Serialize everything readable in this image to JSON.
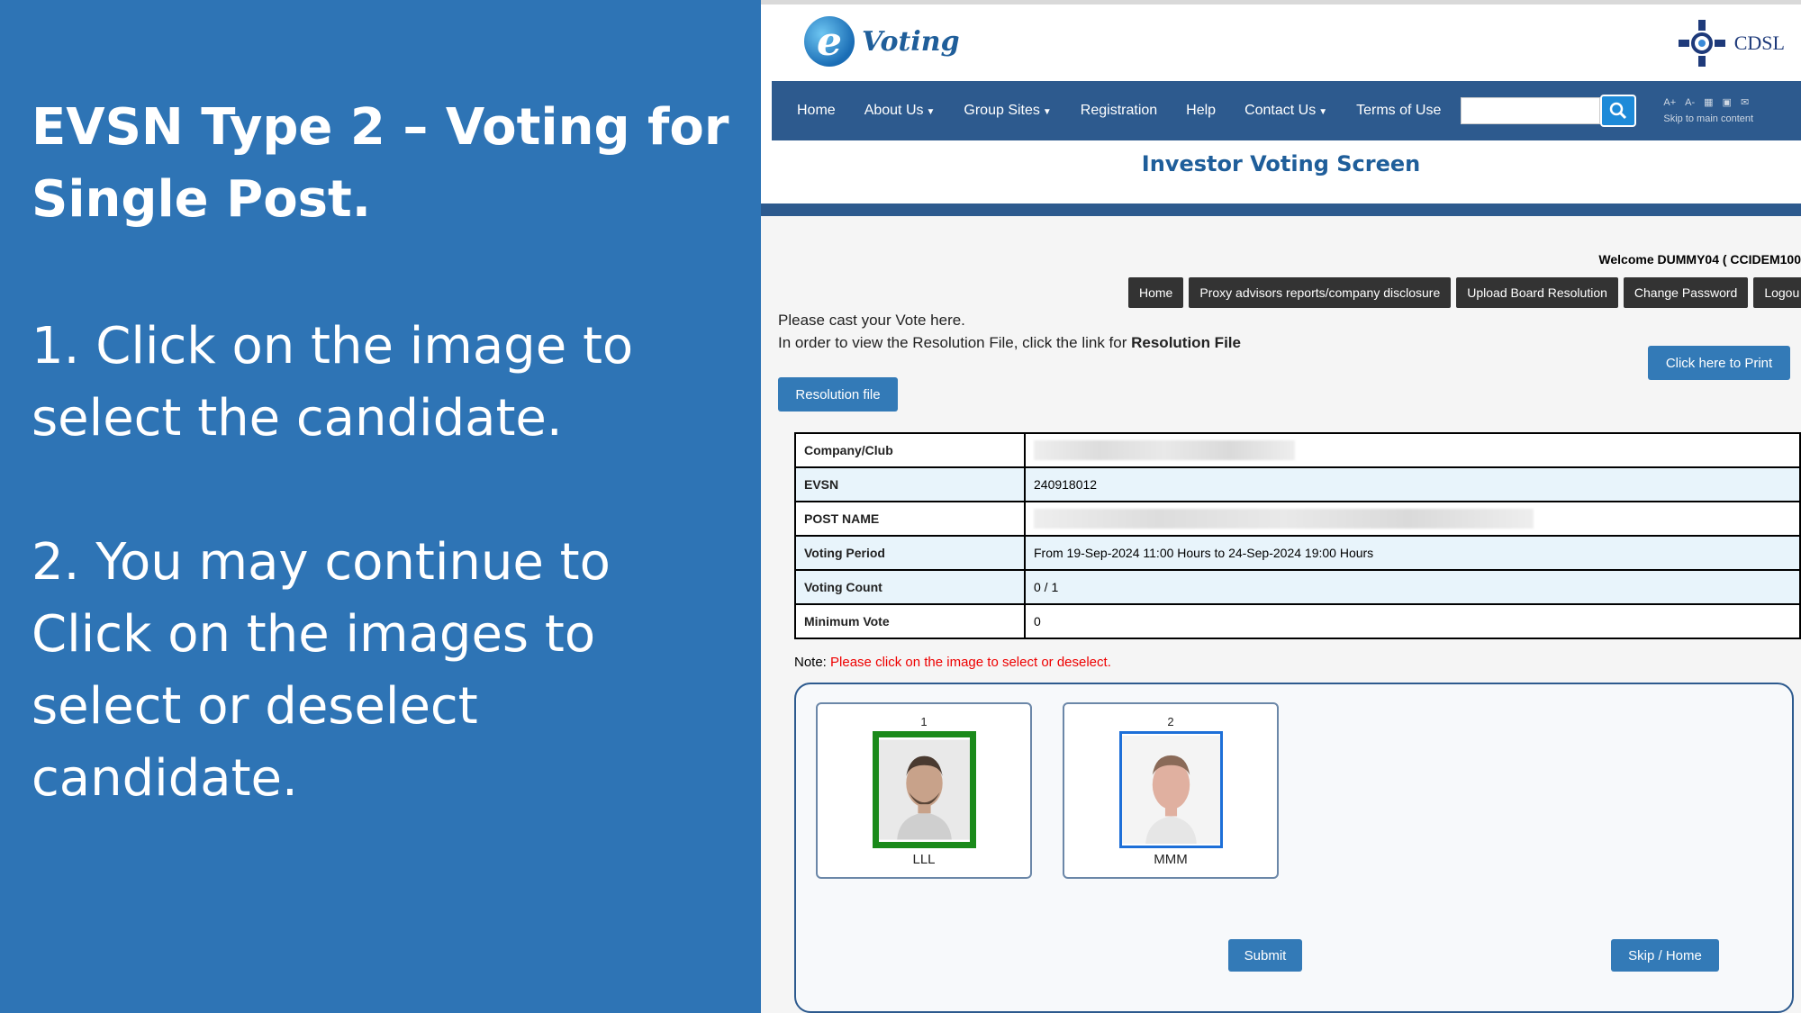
{
  "slide": {
    "title": "EVSN Type 2 – Voting for Single Post.",
    "step1": "1. Click on the image to select the candidate.",
    "step2": "2. You may continue to Click on the images to select or deselect candidate."
  },
  "header": {
    "logo_letter": "e",
    "logo_text": "Voting",
    "brand_right": "CDSL",
    "page_title": "Investor Voting Screen"
  },
  "nav": {
    "items": [
      {
        "label": "Home"
      },
      {
        "label": "About Us"
      },
      {
        "label": "Group Sites"
      },
      {
        "label": "Registration"
      },
      {
        "label": "Help"
      },
      {
        "label": "Contact Us"
      },
      {
        "label": "Terms of Use"
      }
    ],
    "search_placeholder": "",
    "font_up": "A+",
    "font_down": "A-",
    "skip_link": "Skip to main content"
  },
  "user": {
    "welcome": "Welcome DUMMY04 ( CCIDEM100"
  },
  "menu": [
    {
      "label": "Home"
    },
    {
      "label": "Proxy advisors reports/company disclosure"
    },
    {
      "label": "Upload Board Resolution"
    },
    {
      "label": "Change Password"
    },
    {
      "label": "Logou"
    }
  ],
  "instructions": {
    "line1": "Please cast your Vote here.",
    "line2_prefix": "In order to view the Resolution File, click the link for ",
    "line2_bold": "Resolution File"
  },
  "buttons": {
    "print": "Click here to Print",
    "resolution": "Resolution file",
    "submit": "Submit",
    "skip": "Skip / Home"
  },
  "details": [
    {
      "label": "Company/Club",
      "value": ""
    },
    {
      "label": "EVSN",
      "value": "240918012"
    },
    {
      "label": "POST NAME",
      "value": ""
    },
    {
      "label": "Voting Period",
      "value": "From 19-Sep-2024 11:00 Hours to 24-Sep-2024 19:00 Hours"
    },
    {
      "label": "Voting Count",
      "value": "0 / 1"
    },
    {
      "label": "Minimum Vote",
      "value": "0"
    }
  ],
  "note": {
    "prefix": "Note: ",
    "text": "Please click on the image to select or deselect."
  },
  "candidates": [
    {
      "number": "1",
      "name": "LLL",
      "selected": true
    },
    {
      "number": "2",
      "name": "MMM",
      "selected": false
    }
  ],
  "colors": {
    "slide_bg": "#2e74b5",
    "nav_bg": "#2d5a8e",
    "button_blue": "#337ab7",
    "selected_border": "#1a8a1a",
    "unselected_border": "#1d6fd8",
    "note_red": "#e00000"
  }
}
